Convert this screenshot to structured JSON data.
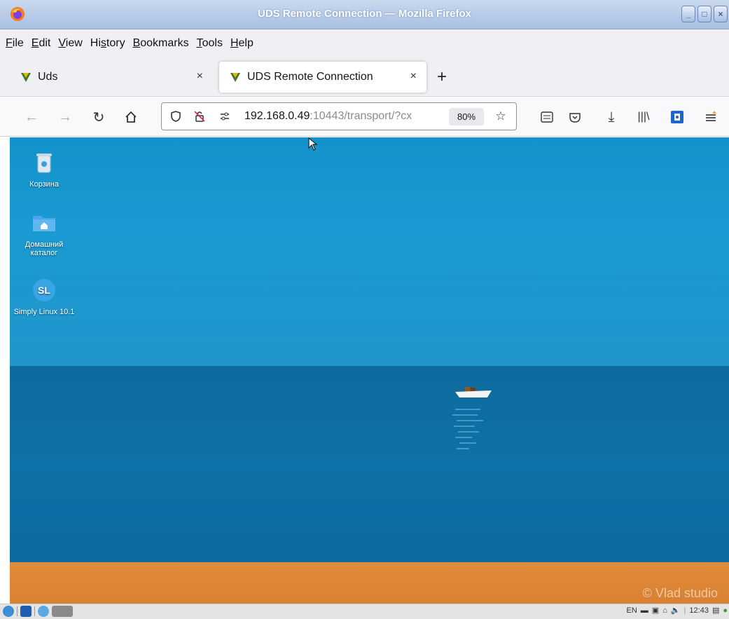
{
  "window": {
    "title": "UDS Remote Connection — Mozilla Firefox"
  },
  "menu": {
    "items": [
      {
        "label": "File",
        "accel": "F",
        "rest": "ile"
      },
      {
        "label": "Edit",
        "accel": "E",
        "rest": "dit"
      },
      {
        "label": "View",
        "accel": "V",
        "rest": "iew"
      },
      {
        "label": "History",
        "pre": "Hi",
        "accel": "s",
        "rest": "tory"
      },
      {
        "label": "Bookmarks",
        "accel": "B",
        "rest": "ookmarks"
      },
      {
        "label": "Tools",
        "accel": "T",
        "rest": "ools"
      },
      {
        "label": "Help",
        "accel": "H",
        "rest": "elp"
      }
    ]
  },
  "tabs": [
    {
      "label": "Uds",
      "active": false,
      "close": "×"
    },
    {
      "label": "UDS Remote Connection",
      "active": true,
      "close": "×"
    }
  ],
  "new_tab_label": "+",
  "nav": {
    "url_host": "192.168.0.49",
    "url_path": ":10443/transport/?cx",
    "zoom": "80%"
  },
  "desktop": {
    "icons": [
      {
        "label": "Корзина"
      },
      {
        "label": "Домашний каталог"
      },
      {
        "label": "Simply Linux 10.1"
      }
    ],
    "watermark": "© Vlad studio"
  },
  "taskbar": {
    "lang": "EN",
    "clock": "12:43"
  },
  "colors": {
    "sky": "#1693c9",
    "sea": "#0d72a7",
    "sand": "#e08b3b",
    "titlebar": "#a9c0e3"
  }
}
